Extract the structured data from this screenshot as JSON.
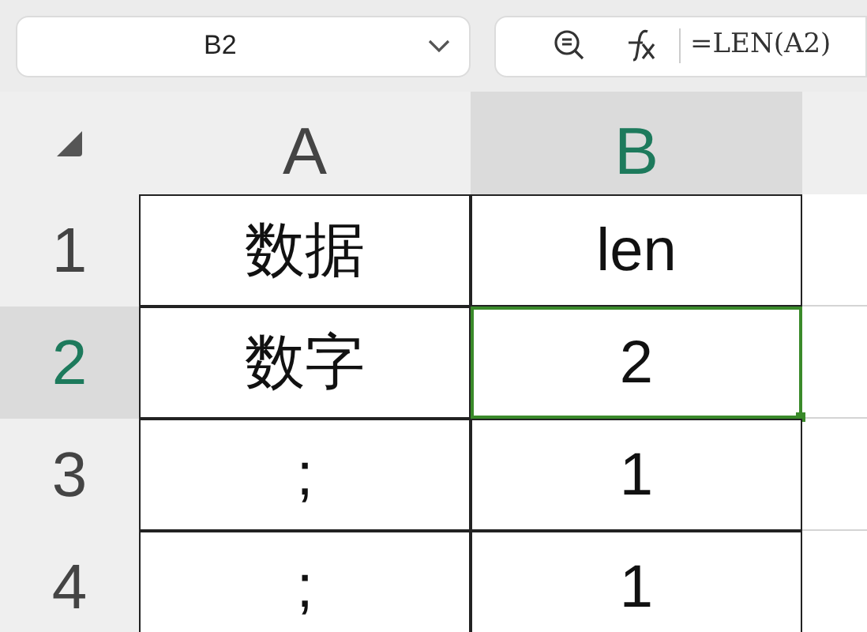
{
  "name_box": {
    "value": "B2"
  },
  "formula_bar": {
    "value": "=LEN(A2)"
  },
  "columns": [
    {
      "label": "A",
      "selected": false
    },
    {
      "label": "B",
      "selected": true
    }
  ],
  "rows": [
    {
      "label": "1",
      "selected": false,
      "cells": [
        {
          "text": "数据",
          "selected": false
        },
        {
          "text": "len",
          "selected": false
        }
      ]
    },
    {
      "label": "2",
      "selected": true,
      "cells": [
        {
          "text": "数字",
          "selected": false
        },
        {
          "text": "2",
          "selected": true
        }
      ]
    },
    {
      "label": "3",
      "selected": false,
      "cells": [
        {
          "text": ";",
          "selected": false
        },
        {
          "text": "1",
          "selected": false
        }
      ]
    },
    {
      "label": "4",
      "selected": false,
      "cells": [
        {
          "text": ";",
          "selected": false
        },
        {
          "text": "1",
          "selected": false
        }
      ]
    }
  ]
}
